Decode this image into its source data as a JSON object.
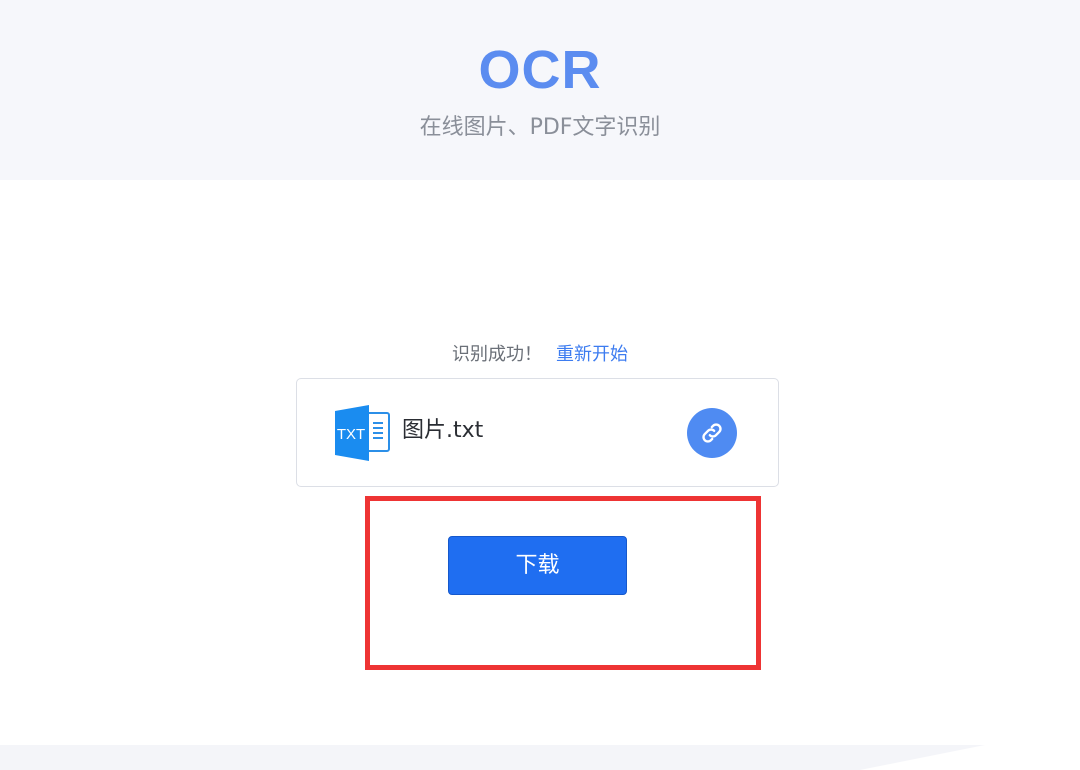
{
  "header": {
    "title": "OCR",
    "subtitle": "在线图片、PDF文字识别"
  },
  "status": {
    "message": "识别成功！",
    "restart_label": "重新开始"
  },
  "file": {
    "icon_label": "TXT",
    "name": "图片.txt",
    "icon": "txt-file-icon",
    "link_icon": "link-icon"
  },
  "actions": {
    "download_label": "下载"
  },
  "colors": {
    "accent": "#5b8cf0",
    "link": "#3d7cf0",
    "button": "#1f6ef1",
    "highlight": "#ee3434"
  }
}
